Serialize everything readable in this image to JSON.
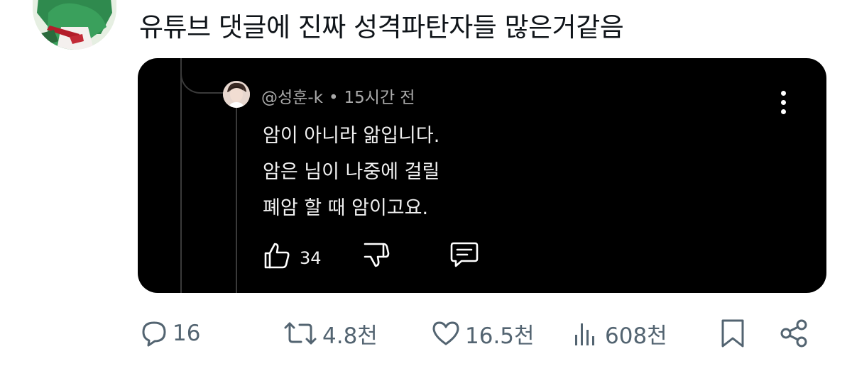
{
  "post": {
    "text": "유튜브 댓글에 진짜 성격파탄자들 많은거같음"
  },
  "comment": {
    "username": "@성훈-k",
    "separator": "•",
    "time": "15시간 전",
    "lines": [
      "암이 아니라 앎입니다.",
      "암은 님이 나중에 걸릴",
      "폐암 할 때 암이고요."
    ],
    "like_count": "34"
  },
  "actions": {
    "replies": "16",
    "reposts": "4.8천",
    "likes": "16.5천",
    "views": "608천"
  },
  "colors": {
    "text": "#0f1419",
    "muted": "#536471",
    "embed_bg": "#000000",
    "embed_text": "#f1f1f1",
    "embed_meta": "#aaaaaa"
  },
  "icons": [
    "avatar",
    "thumbs-up-icon",
    "thumbs-down-icon",
    "reply-icon",
    "kebab-icon",
    "comment-icon",
    "repost-icon",
    "heart-icon",
    "views-icon",
    "bookmark-icon",
    "share-icon"
  ]
}
